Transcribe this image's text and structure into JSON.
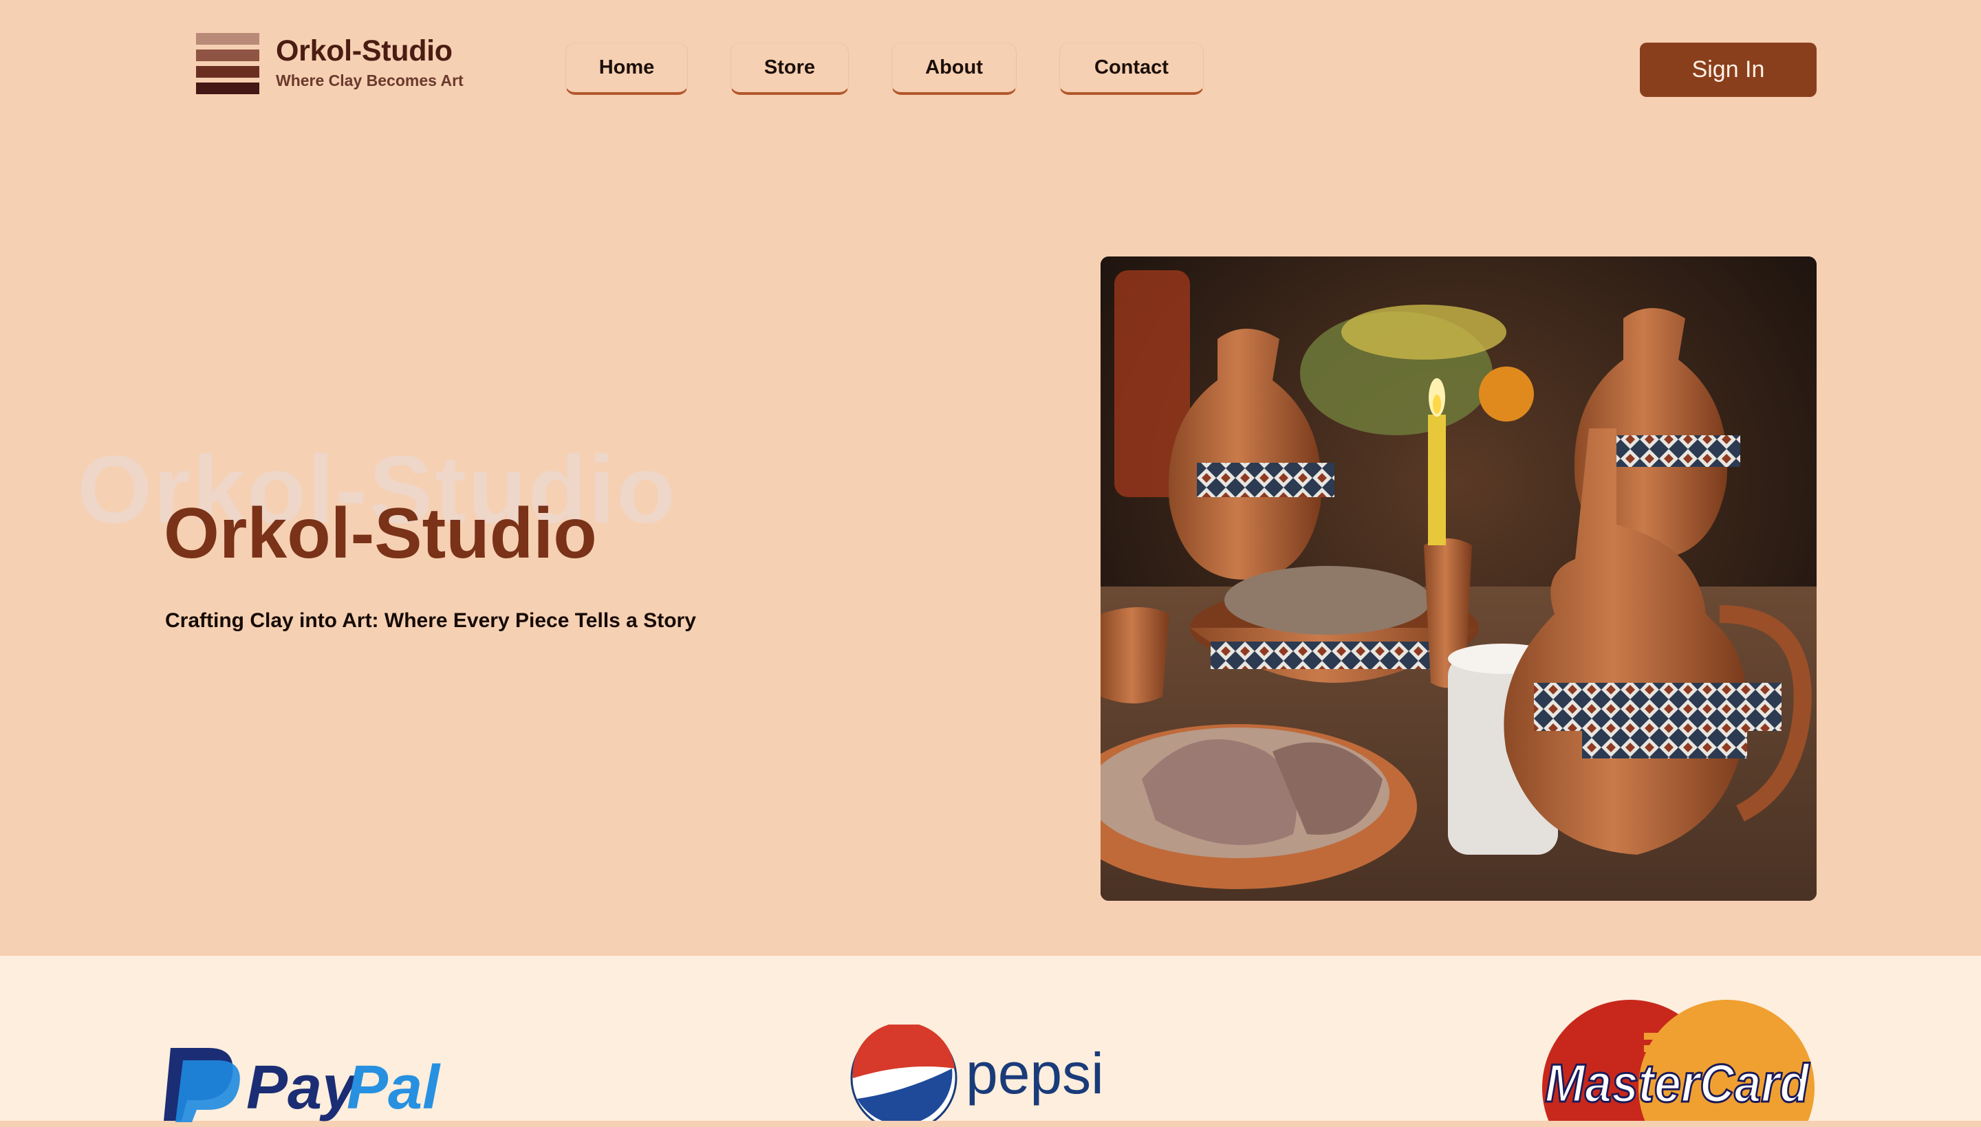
{
  "brand": {
    "title": "Orkol-Studio",
    "subtitle": "Where Clay Becomes Art",
    "colors": [
      "#b98a77",
      "#8f5444",
      "#6b2f22",
      "#431815"
    ]
  },
  "nav": {
    "home": "Home",
    "store": "Store",
    "about": "About",
    "contact": "Contact"
  },
  "header": {
    "signin_label": "Sign In"
  },
  "hero": {
    "ghost_text": "Orkol-Studio",
    "title": "Orkol-Studio",
    "tagline": "Crafting Clay into Art: Where Every Piece Tells a Story",
    "image_subject": "pottery-table-photo"
  },
  "partners": {
    "paypal": {
      "name": "PayPal",
      "word1": "Pay",
      "word2": "Pal"
    },
    "pepsi": {
      "name": "pepsi"
    },
    "mastercard": {
      "name": "MasterCard"
    }
  },
  "colors": {
    "page_bg": "#f6d0b2",
    "accent": "#8a3f1c",
    "title_brown": "#7a3218",
    "partner_bg": "#fdeedd"
  }
}
